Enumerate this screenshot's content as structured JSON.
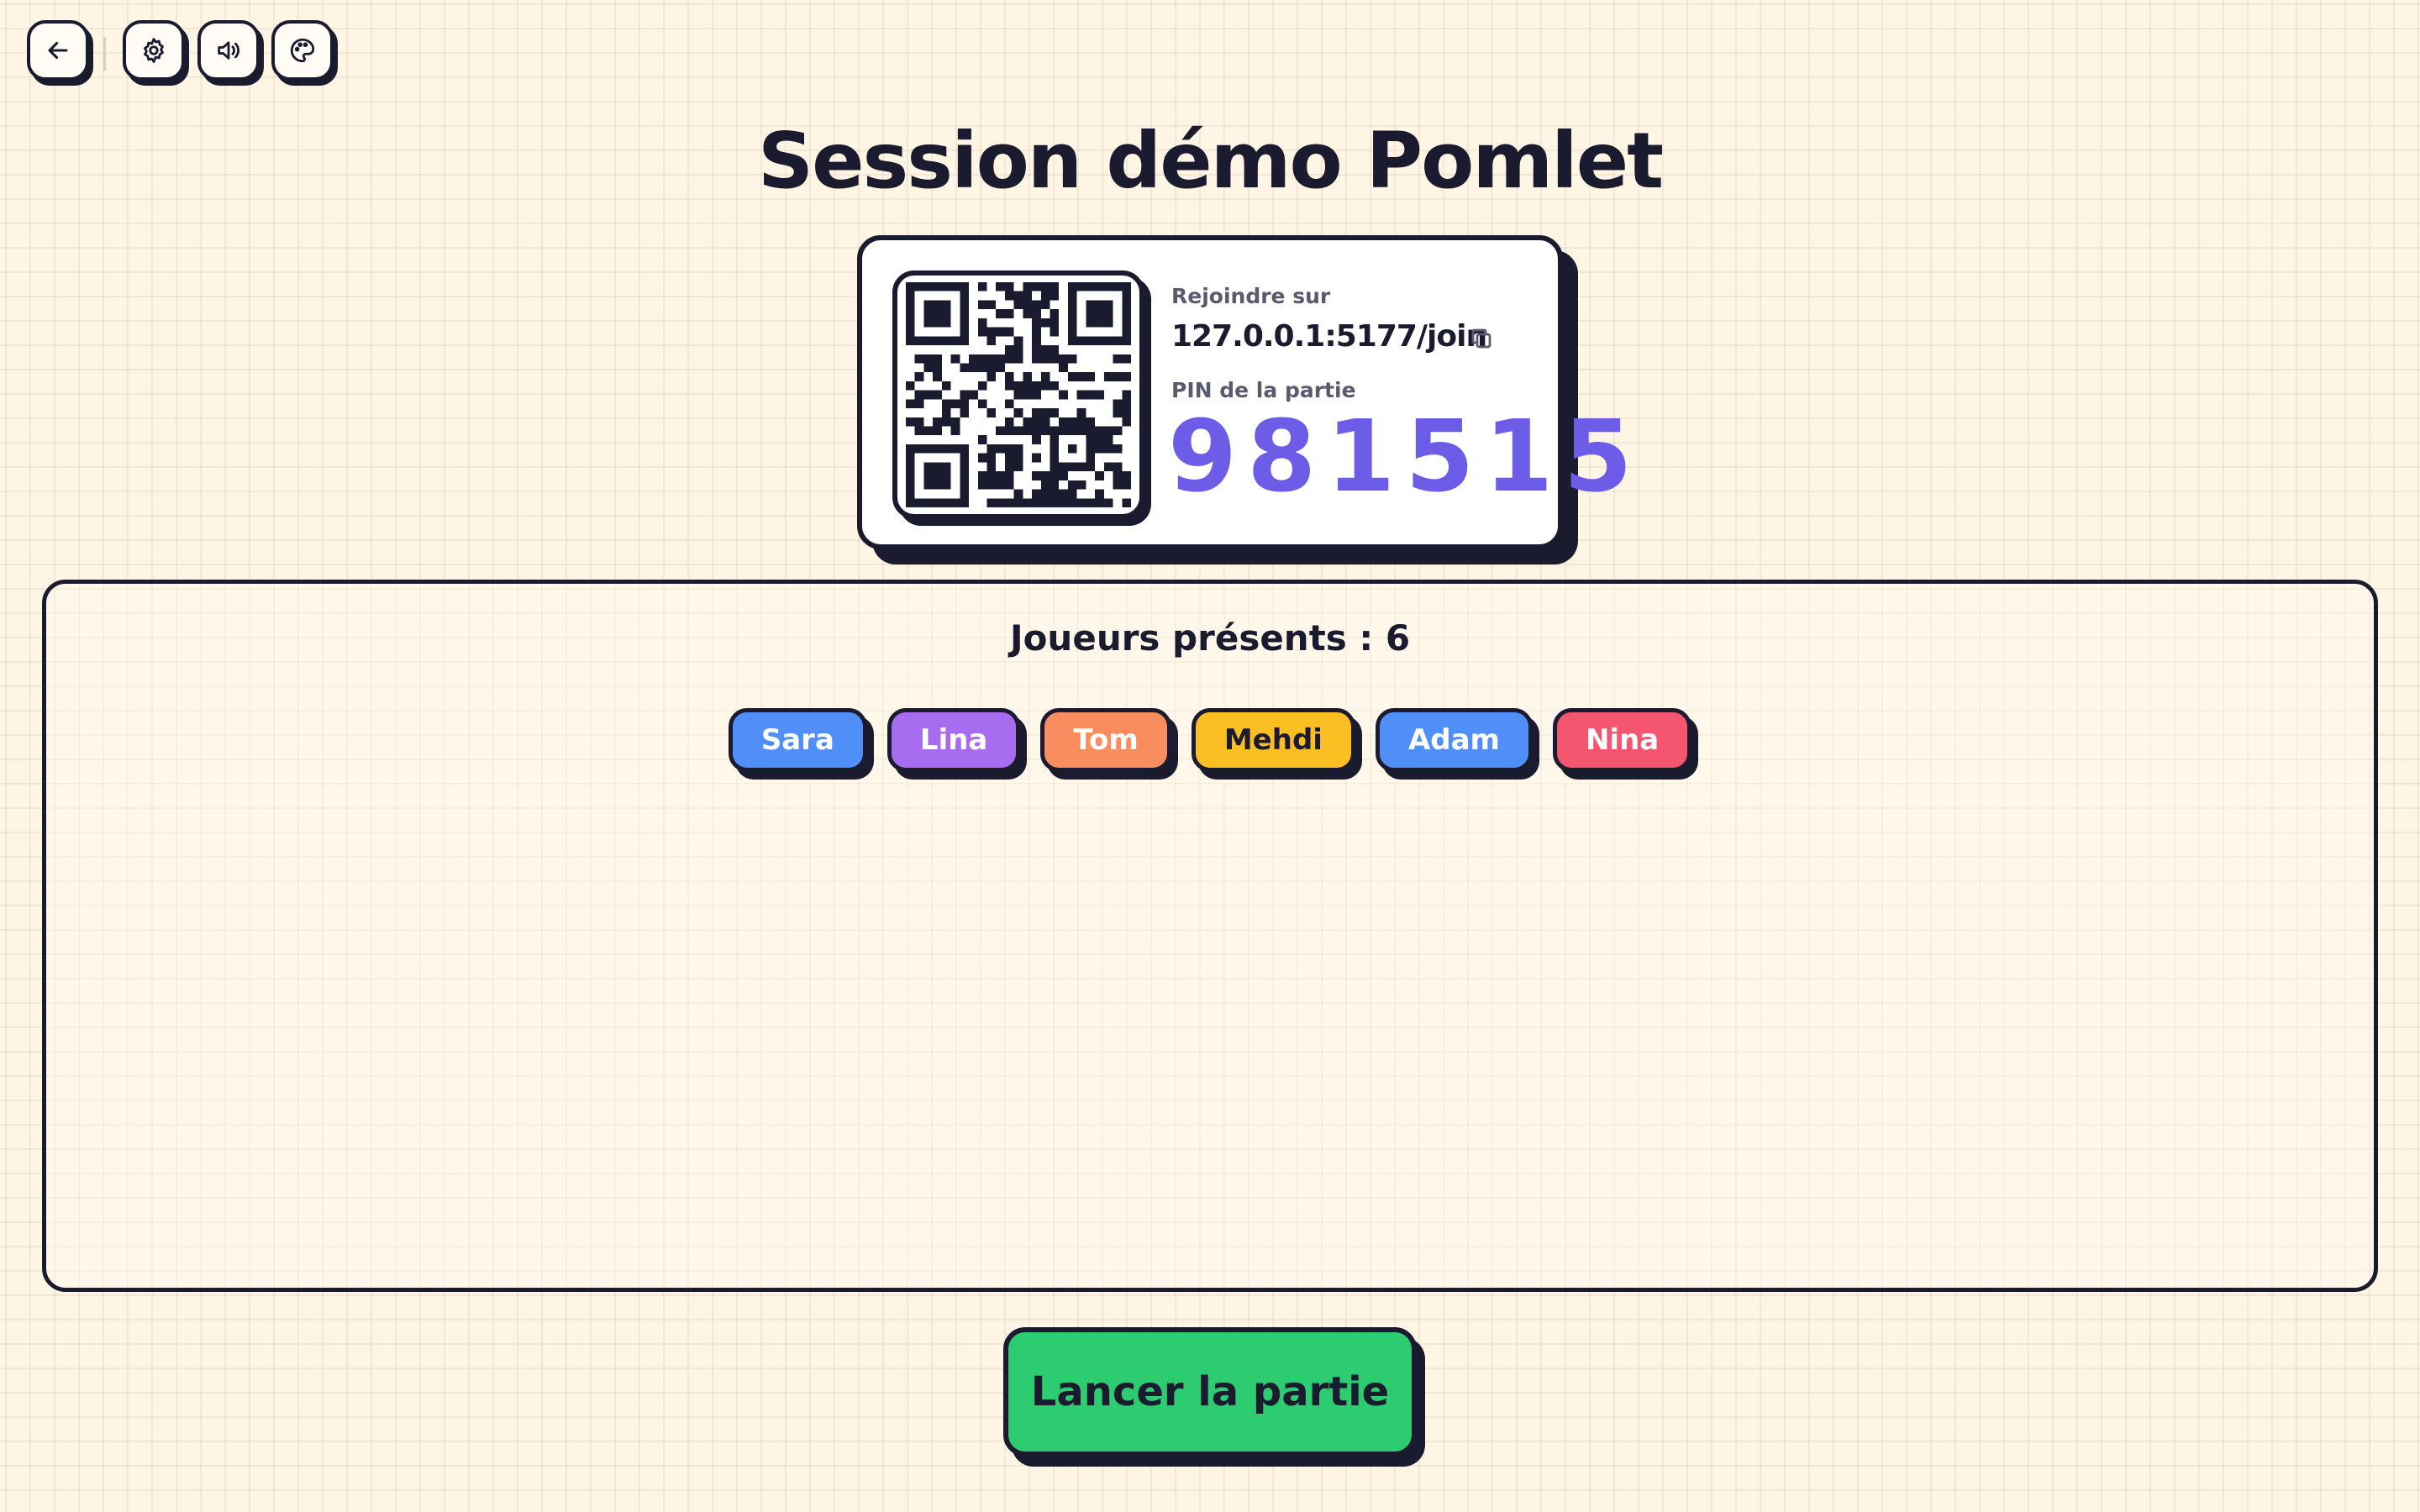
{
  "toolbar": {
    "back_icon": "arrow-left-icon",
    "settings_icon": "gear-icon",
    "sound_icon": "speaker-icon",
    "theme_icon": "palette-icon"
  },
  "title": "Session démo Pomlet",
  "join": {
    "label": "Rejoindre sur",
    "url": "127.0.0.1:5177/join",
    "copy_icon": "copy-icon",
    "pin_label": "PIN de la partie",
    "pin": "981515",
    "pin_color": "#6c5ce7"
  },
  "players": {
    "title": "Joueurs présents : 6",
    "list": [
      {
        "name": "Sara",
        "color": "#4f8ff7",
        "text_color": "#ffffff"
      },
      {
        "name": "Lina",
        "color": "#a86cf0",
        "text_color": "#ffffff"
      },
      {
        "name": "Tom",
        "color": "#fa8d5f",
        "text_color": "#ffffff"
      },
      {
        "name": "Mehdi",
        "color": "#fbbf24",
        "text_color": "#1b1b2f"
      },
      {
        "name": "Adam",
        "color": "#4f8ff7",
        "text_color": "#ffffff"
      },
      {
        "name": "Nina",
        "color": "#f3566e",
        "text_color": "#ffffff"
      }
    ]
  },
  "launch_label": "Lancer la partie",
  "colors": {
    "background": "#fff5e4",
    "ink": "#1b1b2f",
    "launch": "#2ecc71"
  }
}
